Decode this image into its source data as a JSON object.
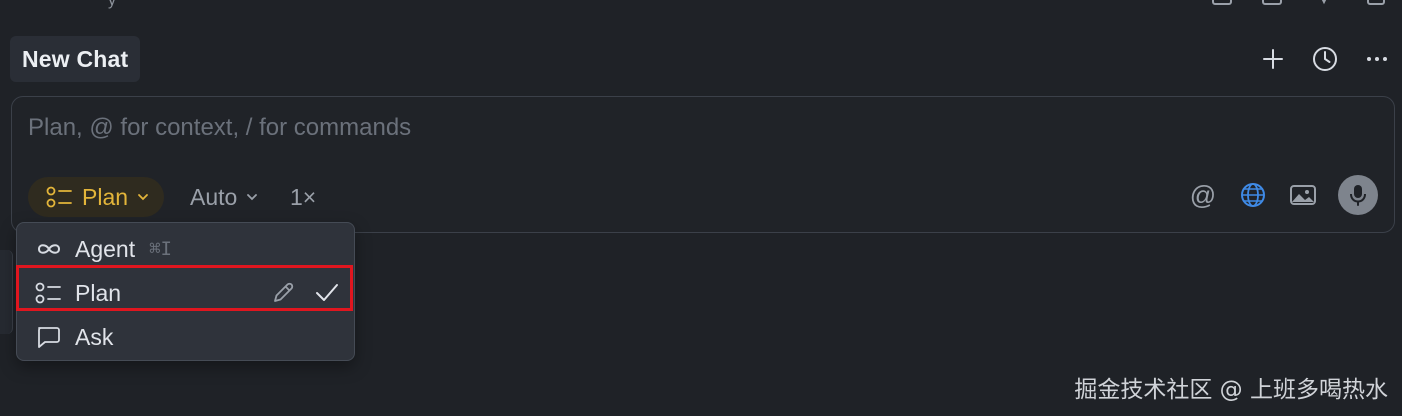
{
  "header": {
    "tab_title": "New Chat",
    "actions": [
      {
        "name": "new-chat",
        "icon": "plus-icon"
      },
      {
        "name": "history",
        "icon": "clock-icon"
      },
      {
        "name": "more",
        "icon": "ellipsis-icon"
      }
    ]
  },
  "top_strip": {
    "partial_text": "y"
  },
  "composer": {
    "placeholder": "Plan, @ for context, / for commands",
    "mode": {
      "label": "Plan",
      "color": "#e3b53a",
      "icon": "plan-list-icon"
    },
    "model": {
      "label": "Auto"
    },
    "multiplier": "1×",
    "tools": [
      {
        "name": "mention",
        "icon": "at-icon",
        "glyph": "@"
      },
      {
        "name": "web",
        "icon": "globe-icon",
        "color": "#3f8ae6"
      },
      {
        "name": "image",
        "icon": "image-icon"
      },
      {
        "name": "voice",
        "icon": "microphone-icon"
      }
    ]
  },
  "mode_menu": {
    "items": [
      {
        "label": "Agent",
        "icon": "infinity-icon",
        "shortcut": "⌘I"
      },
      {
        "label": "Plan",
        "icon": "plan-list-icon",
        "selected": true,
        "editable": true
      },
      {
        "label": "Ask",
        "icon": "chat-bubble-icon"
      }
    ],
    "highlight_color": "#e0161f"
  },
  "watermark": "掘金技术社区 @ 上班多喝热水"
}
